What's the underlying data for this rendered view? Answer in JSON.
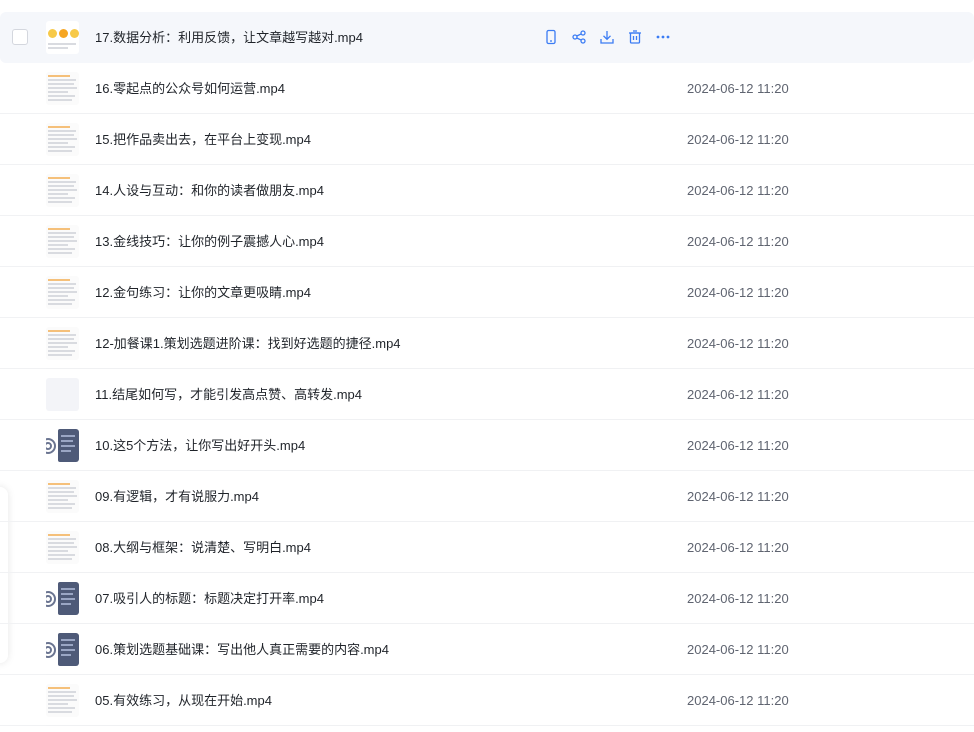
{
  "accent_color": "#3b7cf4",
  "row_actions": [
    {
      "icon": "mobile-icon",
      "name": "view-on-phone-button"
    },
    {
      "icon": "share-icon",
      "name": "share-button"
    },
    {
      "icon": "download-icon",
      "name": "download-button"
    },
    {
      "icon": "trash-icon",
      "name": "delete-button"
    },
    {
      "icon": "more-icon",
      "name": "more-button"
    }
  ],
  "files": [
    {
      "name": "17.数据分析：利用反馈，让文章越写越对.mp4",
      "date": "",
      "thumb": "yellow"
    },
    {
      "name": "16.零起点的公众号如何运营.mp4",
      "date": "2024-06-12 11:20",
      "thumb": "doc"
    },
    {
      "name": "15.把作品卖出去，在平台上变现.mp4",
      "date": "2024-06-12 11:20",
      "thumb": "doc"
    },
    {
      "name": "14.人设与互动：和你的读者做朋友.mp4",
      "date": "2024-06-12 11:20",
      "thumb": "doc"
    },
    {
      "name": "13.金线技巧：让你的例子震撼人心.mp4",
      "date": "2024-06-12 11:20",
      "thumb": "doc"
    },
    {
      "name": "12.金句练习：让你的文章更吸睛.mp4",
      "date": "2024-06-12 11:20",
      "thumb": "doc"
    },
    {
      "name": "12-加餐课1.策划选题进阶课：找到好选题的捷径.mp4",
      "date": "2024-06-12 11:20",
      "thumb": "doc"
    },
    {
      "name": "11.结尾如何写，才能引发高点赞、高转发.mp4",
      "date": "2024-06-12 11:20",
      "thumb": "blank"
    },
    {
      "name": "10.这5个方法，让你写出好开头.mp4",
      "date": "2024-06-12 11:20",
      "thumb": "dark"
    },
    {
      "name": "09.有逻辑，才有说服力.mp4",
      "date": "2024-06-12 11:20",
      "thumb": "doc"
    },
    {
      "name": "08.大纲与框架：说清楚、写明白.mp4",
      "date": "2024-06-12 11:20",
      "thumb": "doc"
    },
    {
      "name": "07.吸引人的标题：标题决定打开率.mp4",
      "date": "2024-06-12 11:20",
      "thumb": "dark"
    },
    {
      "name": "06.策划选题基础课：写出他人真正需要的内容.mp4",
      "date": "2024-06-12 11:20",
      "thumb": "dark"
    },
    {
      "name": "05.有效练习，从现在开始.mp4",
      "date": "2024-06-12 11:20",
      "thumb": "doc"
    }
  ]
}
